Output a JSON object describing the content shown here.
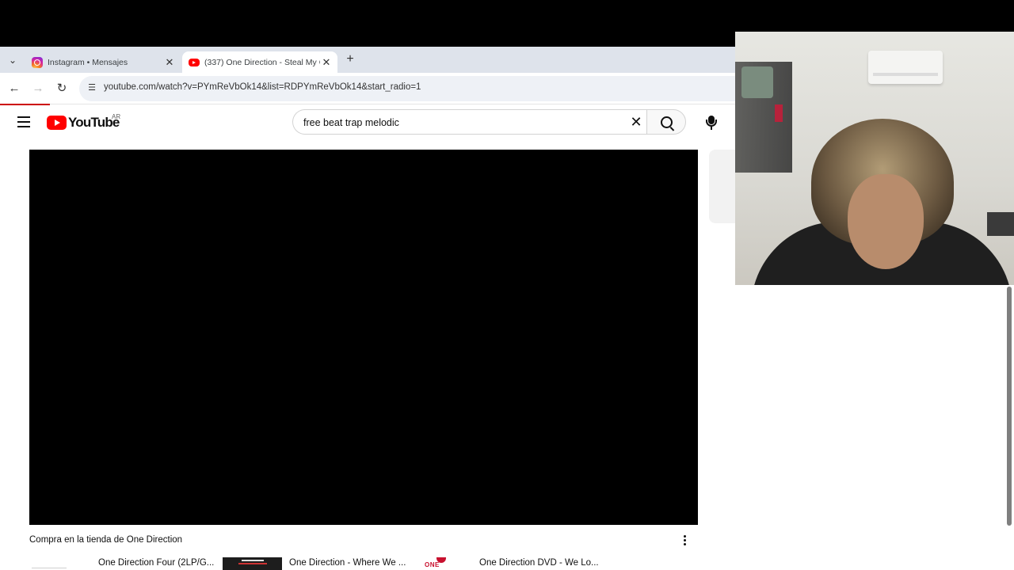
{
  "browser": {
    "tabs": [
      {
        "title": "Instagram • Mensajes",
        "favicon": "instagram-icon",
        "active": false
      },
      {
        "title": "(337) One Direction - Steal My G",
        "favicon": "youtube-icon",
        "active": true
      }
    ],
    "url": "youtube.com/watch?v=PYmReVbOk14&list=RDPYmReVbOk14&start_radio=1"
  },
  "youtube": {
    "logo_text": "YouTube",
    "country_code": "AR",
    "search": {
      "value": "free beat trap melodic"
    }
  },
  "store": {
    "title": "Compra en la tienda de One Direction",
    "items": [
      {
        "name": "One Direction Four (2LP/G..."
      },
      {
        "name": "One Direction - Where We ..."
      },
      {
        "name": "One Direction DVD - We Lo..."
      }
    ],
    "thumb_3_text": "ONE"
  },
  "colors": {
    "accent": "#ff0000",
    "progress": "#cc0000",
    "tab_strip": "#dee3eb"
  }
}
